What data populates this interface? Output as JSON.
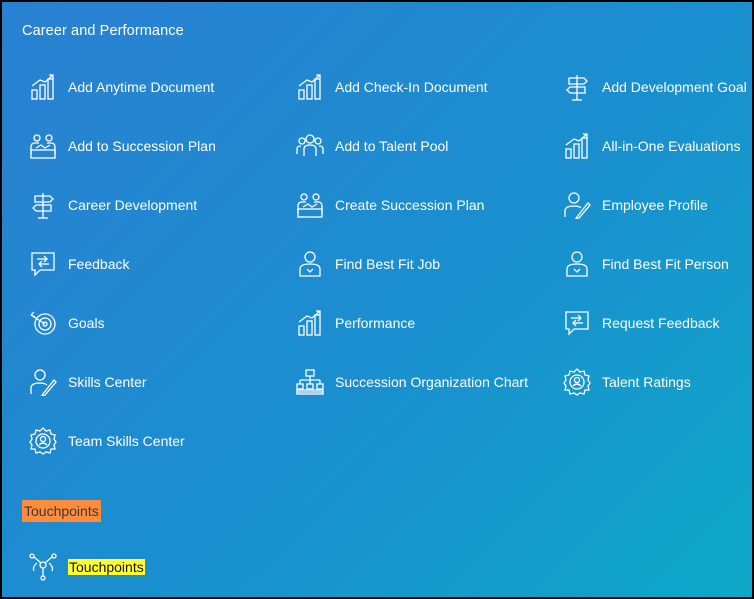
{
  "section": {
    "title": "Career and Performance"
  },
  "items": [
    {
      "label": "Add Anytime Document",
      "icon": "bar-chart-icon"
    },
    {
      "label": "Add Check-In Document",
      "icon": "bar-chart-icon"
    },
    {
      "label": "Add Development Goal",
      "icon": "signpost-icon"
    },
    {
      "label": "Add to Succession Plan",
      "icon": "handshake-icon"
    },
    {
      "label": "Add to Talent Pool",
      "icon": "group-icon"
    },
    {
      "label": "All-in-One Evaluations",
      "icon": "bar-chart-icon"
    },
    {
      "label": "Career Development",
      "icon": "signpost-icon"
    },
    {
      "label": "Create Succession Plan",
      "icon": "handshake-icon"
    },
    {
      "label": "Employee Profile",
      "icon": "person-pen-icon"
    },
    {
      "label": "Feedback",
      "icon": "feedback-icon"
    },
    {
      "label": "Find Best Fit Job",
      "icon": "person-badge-icon"
    },
    {
      "label": "Find Best Fit Person",
      "icon": "person-badge-icon"
    },
    {
      "label": "Goals",
      "icon": "target-icon"
    },
    {
      "label": "Performance",
      "icon": "bar-chart-icon"
    },
    {
      "label": "Request Feedback",
      "icon": "feedback-icon"
    },
    {
      "label": "Skills Center",
      "icon": "person-pen-icon"
    },
    {
      "label": "Succession Organization Chart",
      "icon": "org-chart-icon"
    },
    {
      "label": "Talent Ratings",
      "icon": "badge-gear-icon"
    },
    {
      "label": "Team Skills Center",
      "icon": "badge-gear-icon"
    }
  ],
  "touchpoints": {
    "heading": "Touchpoints",
    "item_label": "Touchpoints",
    "item_icon": "network-icon",
    "heading_highlight": "#ff8c3a",
    "item_highlight": "#ffff33"
  },
  "colors": {
    "background_start": "#2a80d2",
    "background_end": "#0da8c8",
    "text": "#ffffff"
  }
}
